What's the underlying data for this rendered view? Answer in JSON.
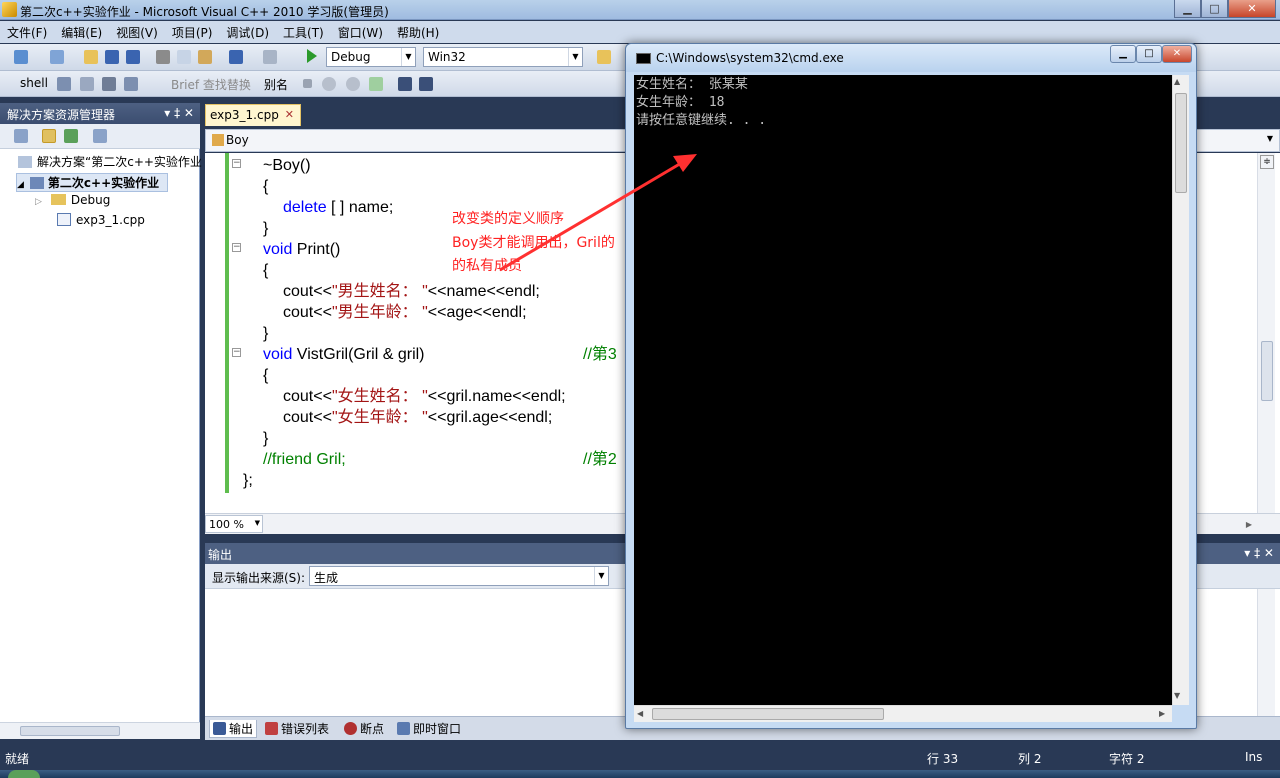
{
  "window": {
    "title": "第二次c++实验作业 - Microsoft Visual C++ 2010 学习版(管理员)",
    "btn_min": "▁",
    "btn_max": "□",
    "btn_close": "✕"
  },
  "menu": [
    "文件(F)",
    "编辑(E)",
    "视图(V)",
    "项目(P)",
    "调试(D)",
    "工具(T)",
    "窗口(W)",
    "帮助(H)"
  ],
  "toolbar": {
    "config": "Debug",
    "platform": "Win32",
    "shell": "shell",
    "brief": "Brief 查找替换",
    "alias": "别名"
  },
  "solution": {
    "header": "解决方案资源管理器",
    "pin": "▾ ‡ ✕",
    "items": [
      {
        "label": "解决方案“第二次c++实验作业"
      },
      {
        "label": "第二次c++实验作业"
      },
      {
        "label": "Debug"
      },
      {
        "label": "exp3_1.cpp"
      }
    ]
  },
  "editor": {
    "tab": "exp3_1.cpp",
    "nav_class": "Boy",
    "zoom": "100 %",
    "lines": [
      {
        "t": "~Boy()"
      },
      {
        "t": "{"
      },
      {
        "kw": "delete",
        "t": " [ ] name;"
      },
      {
        "t": "}"
      },
      {
        "kw": "void",
        "t": " Print()"
      },
      {
        "t": "{"
      },
      {
        "a": "cout<<",
        "s": "\"男生姓名： \"",
        "b": "<<name<<endl;"
      },
      {
        "a": "cout<<",
        "s": "\"男生年龄： \"",
        "b": "<<age<<endl;"
      },
      {
        "t": "}"
      },
      {
        "kw": "void",
        "t": " VistGril(Gril & gril)",
        "c": "//第3"
      },
      {
        "t": "{"
      },
      {
        "a": "cout<<",
        "s": "\"女生姓名： \"",
        "b": "<<gril.name<<endl;"
      },
      {
        "a": "cout<<",
        "s": "\"女生年龄： \"",
        "b": "<<gril.age<<endl;"
      },
      {
        "t": "}"
      },
      {
        "c1": "//friend Gril;",
        "c": "//第2"
      },
      {
        "t": "};"
      }
    ]
  },
  "annotation": {
    "line1": "改变类的定义顺序",
    "line2": "Boy类才能调用出，Gril的",
    "line3": "的私有成员",
    "color": "#ff2222"
  },
  "output": {
    "header": "输出",
    "source_label": "显示输出来源(S):",
    "source_value": "生成",
    "tabs": [
      "输出",
      "错误列表",
      "断点",
      "即时窗口"
    ]
  },
  "status": {
    "ready": "就绪",
    "line": "行 33",
    "col": "列 2",
    "ch": "字符 2",
    "mode": "Ins"
  },
  "cmd": {
    "title": "C:\\Windows\\system32\\cmd.exe",
    "lines": [
      "女生姓名： 张某某",
      "女生年龄： 18",
      "请按任意键继续. . ."
    ]
  }
}
